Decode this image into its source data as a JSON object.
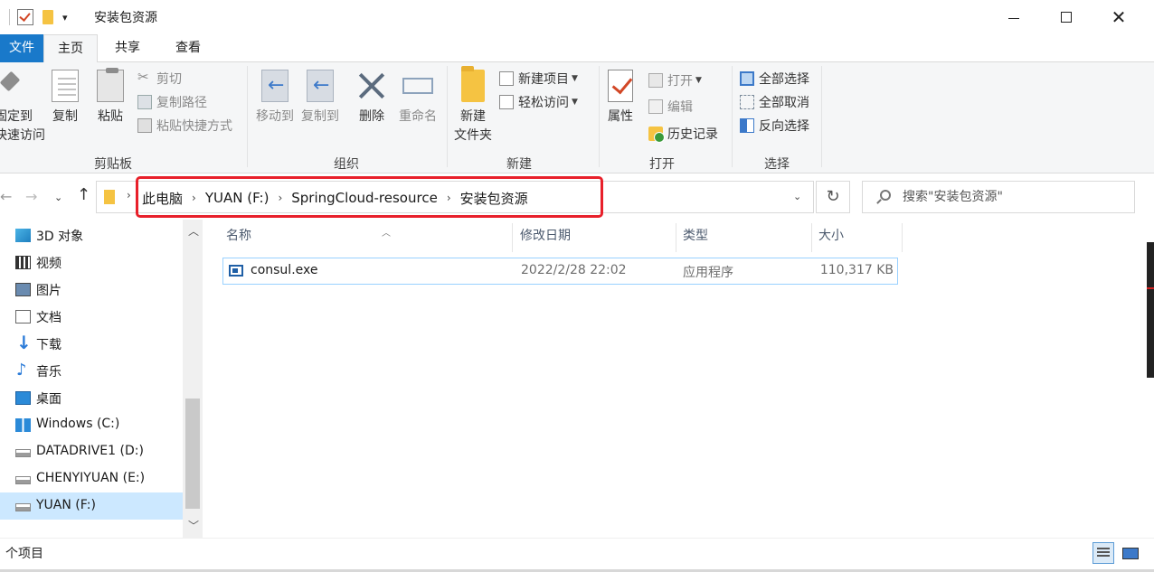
{
  "window": {
    "title": "安装包资源",
    "min_icon": "minimize-icon",
    "max_icon": "maximize-icon",
    "close_icon": "close-icon",
    "close_glyph": "✕"
  },
  "qat": {
    "dropdown_glyph": "▾"
  },
  "tabs": {
    "file": "文件",
    "home": "主页",
    "share": "共享",
    "view": "查看",
    "collapse_glyph": "︿",
    "help_glyph": "?"
  },
  "ribbon": {
    "clipboard": {
      "label": "剪贴板",
      "pin": "固定到\n快速访问",
      "pin_line1": "固定到",
      "pin_line2": "快速访问",
      "copy": "复制",
      "paste": "粘贴",
      "cut": "剪切",
      "copy_path": "复制路径",
      "paste_shortcut": "粘贴快捷方式"
    },
    "organize": {
      "label": "组织",
      "move_to": "移动到",
      "copy_to": "复制到",
      "delete": "删除",
      "rename": "重命名"
    },
    "new": {
      "label": "新建",
      "new_folder_line1": "新建",
      "new_folder_line2": "文件夹",
      "new_item": "新建项目",
      "easy_access": "轻松访问"
    },
    "open": {
      "label": "打开",
      "properties": "属性",
      "open": "打开",
      "edit": "编辑",
      "history": "历史记录"
    },
    "select": {
      "label": "选择",
      "select_all": "全部选择",
      "select_none": "全部取消",
      "invert": "反向选择"
    }
  },
  "nav": {
    "back_glyph": "←",
    "forward_glyph": "→",
    "recent_glyph": "⌄",
    "up_glyph": "↑",
    "breadcrumb": [
      "此电脑",
      "YUAN (F:)",
      "SpringCloud-resource",
      "安装包资源"
    ],
    "sep_glyph": "›",
    "dropdown_glyph": "⌄",
    "refresh_glyph": "↻",
    "search_placeholder": "搜索\"安装包资源\""
  },
  "sidebar": {
    "items": [
      {
        "label": "3D 对象",
        "icon": "3d-objects-icon"
      },
      {
        "label": "视频",
        "icon": "video-icon"
      },
      {
        "label": "图片",
        "icon": "pictures-icon"
      },
      {
        "label": "文档",
        "icon": "documents-icon"
      },
      {
        "label": "下载",
        "icon": "downloads-icon"
      },
      {
        "label": "音乐",
        "icon": "music-icon"
      },
      {
        "label": "桌面",
        "icon": "desktop-icon"
      },
      {
        "label": "Windows  (C:)",
        "icon": "windows-drive-icon"
      },
      {
        "label": "DATADRIVE1 (D:)",
        "icon": "drive-icon"
      },
      {
        "label": "CHENYIYUAN (E:)",
        "icon": "drive-icon"
      },
      {
        "label": "YUAN (F:)",
        "icon": "drive-icon",
        "selected": true
      }
    ],
    "scroll_up_glyph": "︿",
    "scroll_down_glyph": "﹀"
  },
  "filelist": {
    "columns": [
      "名称",
      "修改日期",
      "类型",
      "大小"
    ],
    "sort_glyph": "︿",
    "rows": [
      {
        "name": "consul.exe",
        "modified": "2022/2/28 22:02",
        "type": "应用程序",
        "size": "110,317 KB",
        "icon": "exe-icon"
      }
    ]
  },
  "status": {
    "text": "个项目"
  },
  "colors": {
    "accent": "#1979ca",
    "highlight_box": "#e8202a",
    "selection": "#cce8ff"
  }
}
